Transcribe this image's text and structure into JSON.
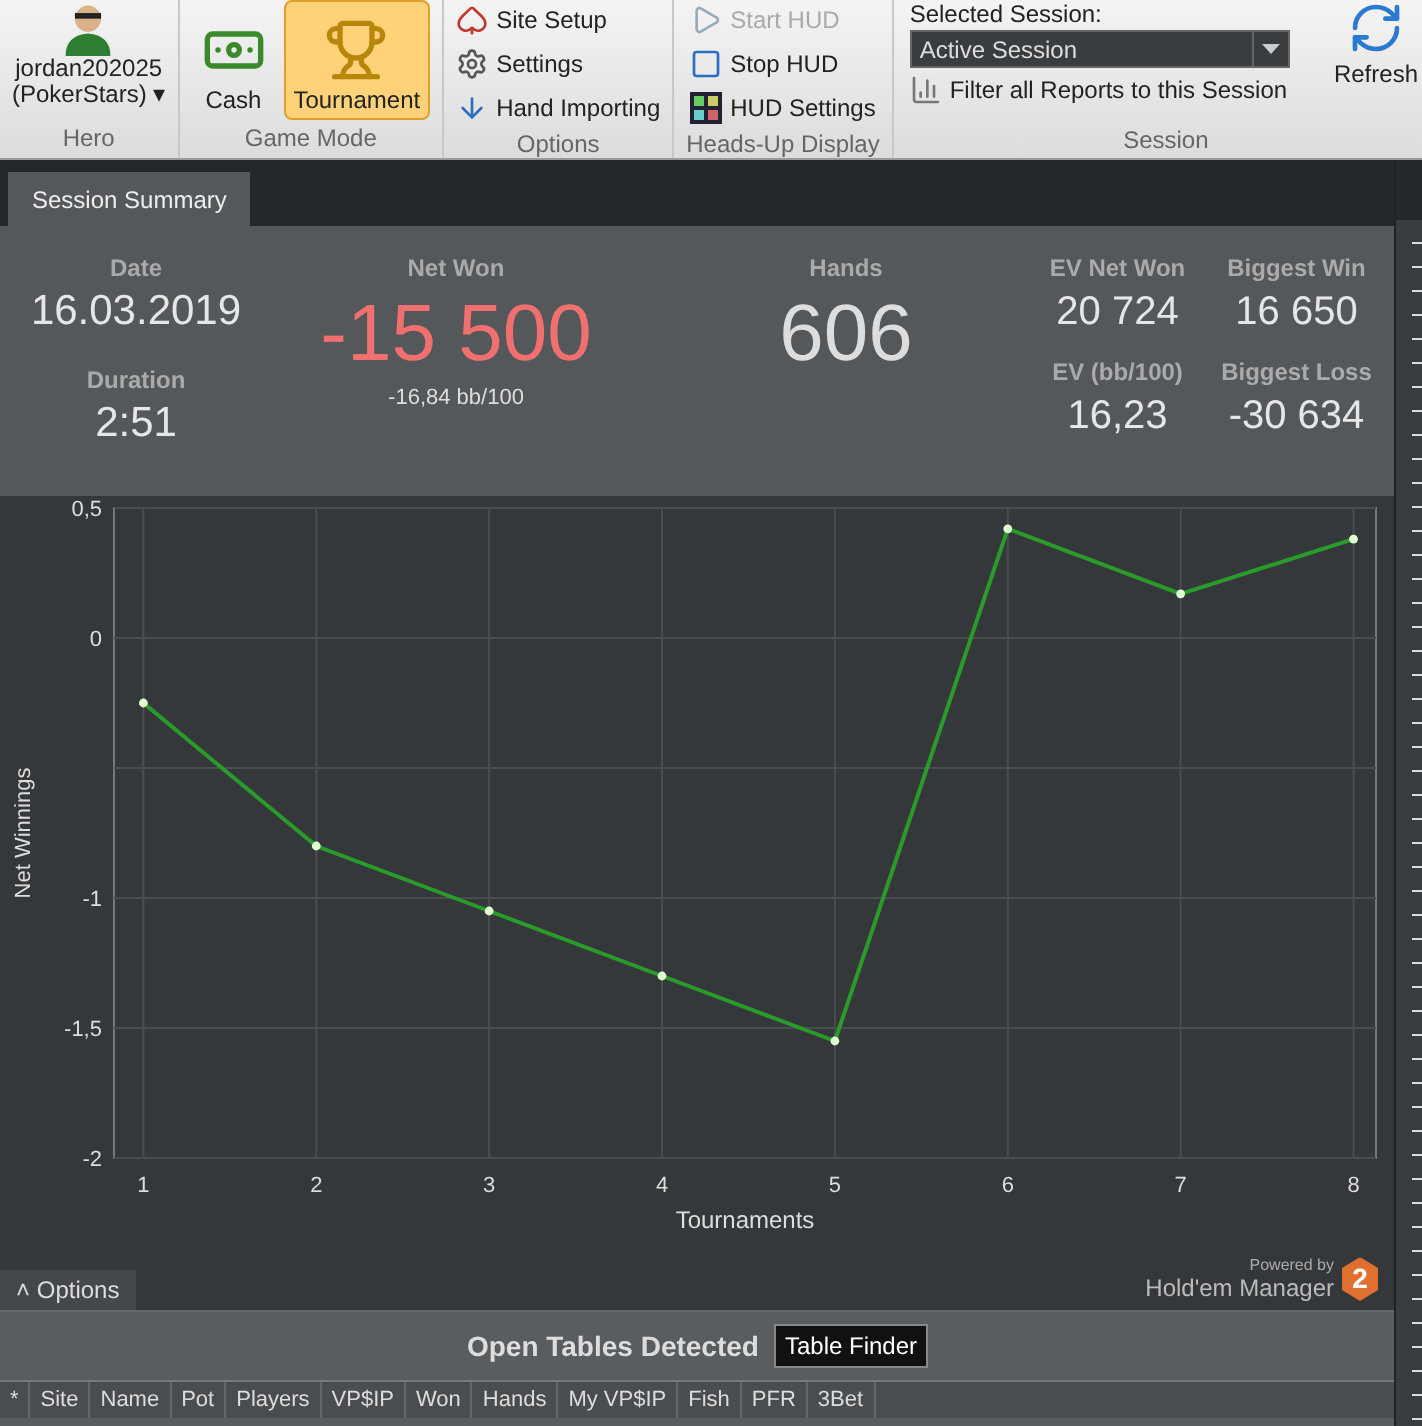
{
  "ribbon": {
    "hero": {
      "name": "jordan202025",
      "site": "(PokerStars)",
      "caret": "▾",
      "group": "Hero"
    },
    "game_mode": {
      "items": [
        {
          "label": "Cash",
          "selected": false
        },
        {
          "label": "Tournament",
          "selected": true
        }
      ],
      "group": "Game Mode"
    },
    "options": {
      "items": [
        {
          "label": "Site Setup"
        },
        {
          "label": "Settings"
        },
        {
          "label": "Hand Importing"
        }
      ],
      "group": "Options"
    },
    "hud": {
      "items": [
        {
          "label": "Start HUD",
          "disabled": true
        },
        {
          "label": "Stop HUD",
          "disabled": false
        },
        {
          "label": "HUD Settings",
          "disabled": false
        }
      ],
      "group": "Heads-Up Display"
    },
    "session": {
      "label": "Selected Session:",
      "value": "Active Session",
      "filter": "Filter all Reports to this Session",
      "refresh": "Refresh",
      "group": "Session"
    }
  },
  "tabs": [
    {
      "label": "Session Summary",
      "selected": true
    }
  ],
  "summary": {
    "date": {
      "label": "Date",
      "value": "16.03.2019"
    },
    "duration": {
      "label": "Duration",
      "value": "2:51"
    },
    "net_won": {
      "label": "Net Won",
      "value": "-15 500",
      "sub": "-16,84 bb/100"
    },
    "hands": {
      "label": "Hands",
      "value": "606"
    },
    "ev_net_won": {
      "label": "EV Net Won",
      "value": "20 724"
    },
    "biggest_win": {
      "label": "Biggest Win",
      "value": "16 650"
    },
    "ev_bb": {
      "label": "EV (bb/100)",
      "value": "16,23"
    },
    "biggest_loss": {
      "label": "Biggest Loss",
      "value": "-30 634"
    }
  },
  "chart": {
    "chart_data": {
      "type": "line",
      "xlabel": "Tournaments",
      "ylabel": "Net Winnings",
      "x": [
        1,
        2,
        3,
        4,
        5,
        6,
        7,
        8
      ],
      "grid": true,
      "series": [
        {
          "color": "#2a9a2a",
          "marker": true,
          "values": [
            -0.25,
            -0.8,
            -1.05,
            -1.3,
            -1.55,
            0.42,
            0.17,
            0.38
          ]
        }
      ],
      "xlim": [
        0.83,
        8.13
      ],
      "ylim": [
        -2,
        0.5
      ],
      "xticks": [
        1,
        2,
        3,
        4,
        5,
        6,
        7,
        8
      ],
      "yticks": [
        {
          "value": 0.5,
          "label": "0,5"
        },
        {
          "value": 0,
          "label": "0"
        },
        {
          "value": -1,
          "label": "-1"
        },
        {
          "value": -1.5,
          "label": "-1,5"
        },
        {
          "value": -2,
          "label": "-2"
        }
      ]
    },
    "options_button": {
      "caret": "˄",
      "label": "Options"
    },
    "branding": {
      "powered": "Powered by",
      "name": "Hold'em Manager",
      "badge": "2"
    }
  },
  "open_tables": {
    "title": "Open Tables Detected",
    "button": "Table Finder",
    "columns": [
      "*",
      "Site",
      "Name",
      "Pot",
      "Players",
      "VP$IP",
      "Won",
      "Hands",
      "My VP$IP",
      "Fish",
      "PFR",
      "3Bet"
    ]
  }
}
